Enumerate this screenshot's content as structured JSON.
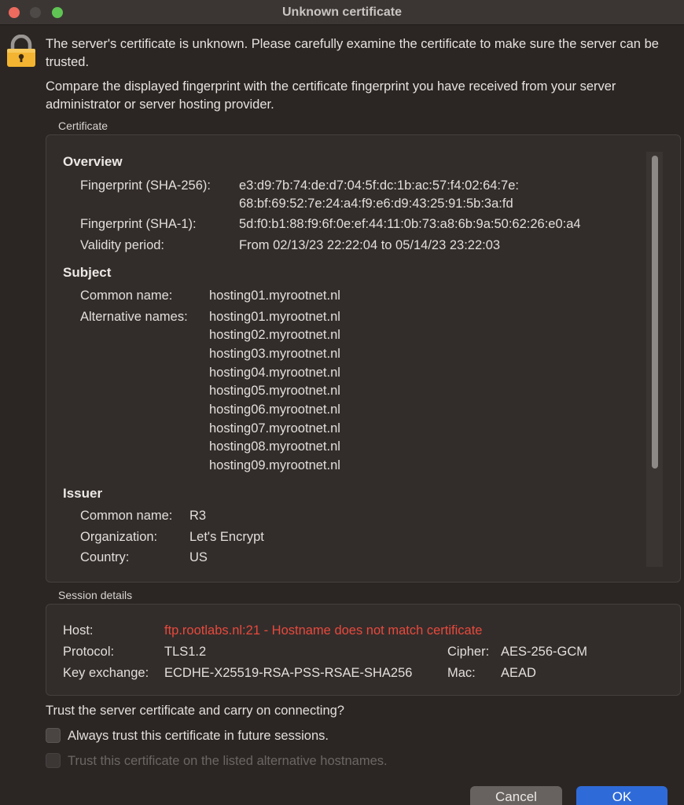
{
  "window": {
    "title": "Unknown certificate"
  },
  "message": {
    "line1": "The server's certificate is unknown. Please carefully examine the certificate to make sure the server can be trusted.",
    "line2": "Compare the displayed fingerprint with the certificate fingerprint you have received from your server administrator or server hosting provider."
  },
  "certificate": {
    "group_label": "Certificate",
    "overview": {
      "heading": "Overview",
      "sha256_label": "Fingerprint (SHA-256):",
      "sha256_line1": "e3:d9:7b:74:de:d7:04:5f:dc:1b:ac:57:f4:02:64:7e:",
      "sha256_line2": "68:bf:69:52:7e:24:a4:f9:e6:d9:43:25:91:5b:3a:fd",
      "sha1_label": "Fingerprint (SHA-1):",
      "sha1_value": "5d:f0:b1:88:f9:6f:0e:ef:44:11:0b:73:a8:6b:9a:50:62:26:e0:a4",
      "validity_label": "Validity period:",
      "validity_value": "From 02/13/23 22:22:04 to 05/14/23 23:22:03"
    },
    "subject": {
      "heading": "Subject",
      "common_name_label": "Common name:",
      "common_name_value": "hosting01.myrootnet.nl",
      "alt_names_label": "Alternative names:",
      "alt_names": [
        "hosting01.myrootnet.nl",
        "hosting02.myrootnet.nl",
        "hosting03.myrootnet.nl",
        "hosting04.myrootnet.nl",
        "hosting05.myrootnet.nl",
        "hosting06.myrootnet.nl",
        "hosting07.myrootnet.nl",
        "hosting08.myrootnet.nl",
        "hosting09.myrootnet.nl"
      ]
    },
    "issuer": {
      "heading": "Issuer",
      "common_name_label": "Common name:",
      "common_name_value": "R3",
      "organization_label": "Organization:",
      "organization_value": "Let's Encrypt",
      "country_label": "Country:",
      "country_value": "US"
    }
  },
  "session": {
    "group_label": "Session details",
    "host_label": "Host:",
    "host_value": "ftp.rootlabs.nl:21 - Hostname does not match certificate",
    "protocol_label": "Protocol:",
    "protocol_value": "TLS1.2",
    "key_exchange_label": "Key exchange:",
    "key_exchange_value": "ECDHE-X25519-RSA-PSS-RSAE-SHA256",
    "cipher_label": "Cipher:",
    "cipher_value": "AES-256-GCM",
    "mac_label": "Mac:",
    "mac_value": "AEAD"
  },
  "trust": {
    "question": "Trust the server certificate and carry on connecting?",
    "always_trust_label": "Always trust this certificate in future sessions.",
    "always_trust_checked": false,
    "alt_hostnames_label": "Trust this certificate on the listed alternative hostnames.",
    "alt_hostnames_enabled": false
  },
  "buttons": {
    "cancel": "Cancel",
    "ok": "OK"
  },
  "colors": {
    "warning": "#e8493c",
    "accent": "#2f6bd8",
    "lock": "#f2b431"
  },
  "icons": {
    "lock": "lock-icon"
  }
}
